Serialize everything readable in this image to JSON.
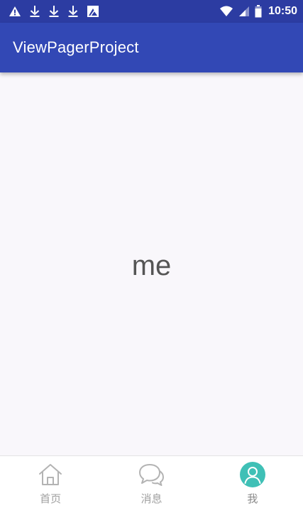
{
  "status_bar": {
    "time": "10:50",
    "left_icons": [
      "warning-icon",
      "download-icon",
      "download-icon",
      "download-icon",
      "gallery-icon"
    ],
    "right_icons": [
      "wifi-icon",
      "signal-icon",
      "battery-icon"
    ]
  },
  "app_bar": {
    "title": "ViewPagerProject"
  },
  "content": {
    "text": "me"
  },
  "bottom_nav": {
    "tabs": [
      {
        "label": "首页",
        "icon": "home-icon",
        "active": false
      },
      {
        "label": "消息",
        "icon": "message-icon",
        "active": false
      },
      {
        "label": "我",
        "icon": "profile-icon",
        "active": true
      }
    ]
  },
  "colors": {
    "status_bar": "#2c3ca2",
    "app_bar": "#3248b5",
    "content_bg": "#f9f7fb",
    "active_icon": "#3fc0b6",
    "inactive_icon": "#b3b3b3",
    "nav_label": "#a0a0a0"
  }
}
